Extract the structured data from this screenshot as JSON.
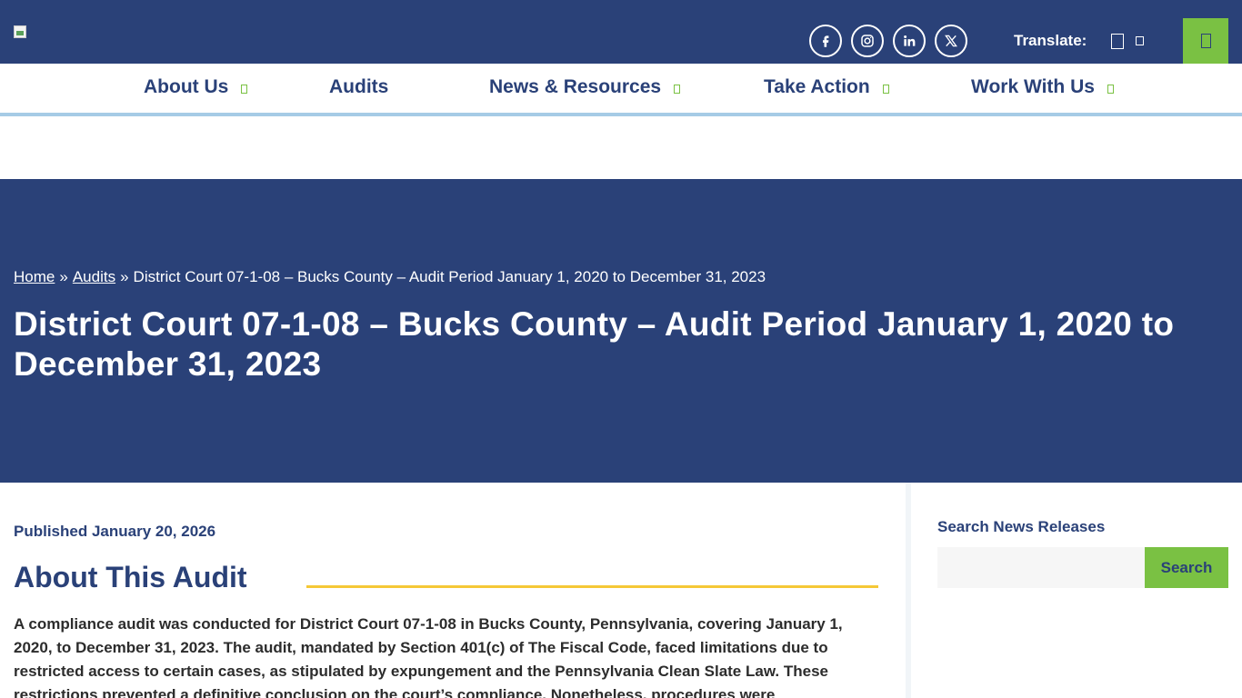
{
  "header": {
    "logo_alt": "",
    "social": [
      {
        "name": "facebook",
        "icon": "facebook-icon"
      },
      {
        "name": "instagram",
        "icon": "instagram-icon"
      },
      {
        "name": "linkedin",
        "icon": "linkedin-icon"
      },
      {
        "name": "x",
        "icon": "x-icon"
      }
    ],
    "translate_label": "Translate:",
    "menu_icon": "menu-icon"
  },
  "nav": {
    "items": [
      {
        "label": "About Us",
        "has_dropdown": true
      },
      {
        "label": "Audits",
        "has_dropdown": false
      },
      {
        "label": "News & Resources",
        "has_dropdown": true
      },
      {
        "label": "Take Action",
        "has_dropdown": true
      },
      {
        "label": "Work With Us",
        "has_dropdown": true
      }
    ]
  },
  "breadcrumb": {
    "home": "Home",
    "separator": "»",
    "audits": "Audits",
    "current": "District Court 07-1-08 – Bucks County – Audit Period January 1, 2020 to December 31, 2023"
  },
  "page": {
    "title": "District Court 07-1-08 – Bucks County – Audit Period January 1, 2020 to December 31, 2023",
    "published": "Published January 20, 2026",
    "section_heading": "About This Audit",
    "body": "A compliance audit was conducted for District Court 07-1-08 in Bucks County, Pennsylvania, covering January 1, 2020, to December 31, 2023. The audit, mandated by Section 401(c) of The Fiscal Code, faced limitations due to restricted access to certain cases, as stipulated by expungement and the Pennsylvania Clean Slate Law. These restrictions prevented a definitive conclusion on the court’s compliance. Nonetheless, procedures were"
  },
  "sidebar": {
    "title": "Search News Releases",
    "search_placeholder": "",
    "search_button": "Search"
  },
  "colors": {
    "brand_navy": "#2a4178",
    "accent_green": "#7ac143",
    "accent_yellow": "#f5c836",
    "nav_rule_blue": "#a6cbe6"
  }
}
